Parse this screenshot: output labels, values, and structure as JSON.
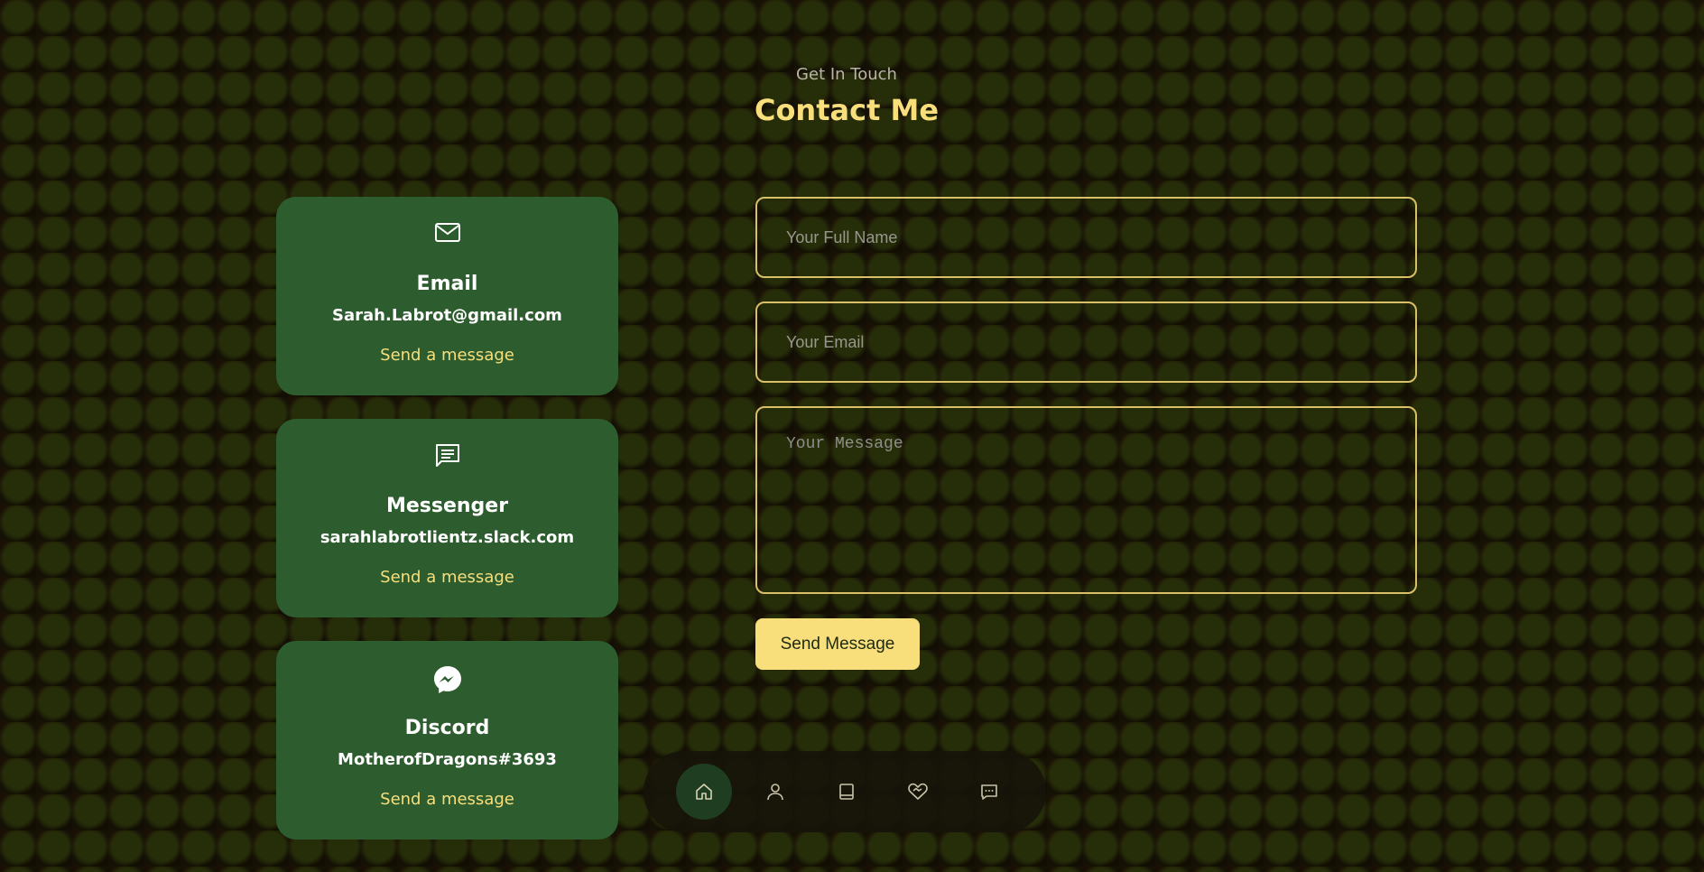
{
  "header": {
    "subtitle": "Get In Touch",
    "title": "Contact Me"
  },
  "cards": [
    {
      "icon": "mail-icon",
      "title": "Email",
      "value": "Sarah.Labrot@gmail.com",
      "link": "Send a message"
    },
    {
      "icon": "chat-icon",
      "title": "Messenger",
      "value": "sarahlabrotlientz.slack.com",
      "link": "Send a message"
    },
    {
      "icon": "messenger-icon",
      "title": "Discord",
      "value": "MotherofDragons#3693",
      "link": "Send a message"
    }
  ],
  "form": {
    "name_placeholder": "Your Full Name",
    "email_placeholder": "Your Email",
    "message_placeholder": "Your Message",
    "submit_label": "Send Message"
  },
  "nav": {
    "items": [
      {
        "icon": "home-icon",
        "active": true
      },
      {
        "icon": "user-icon",
        "active": false
      },
      {
        "icon": "book-icon",
        "active": false
      },
      {
        "icon": "heart-handshake-icon",
        "active": false
      },
      {
        "icon": "message-icon",
        "active": false
      }
    ]
  },
  "colors": {
    "accent": "#f8df7c",
    "card": "#2d5d2f",
    "nav_active": "#1f3d21"
  }
}
